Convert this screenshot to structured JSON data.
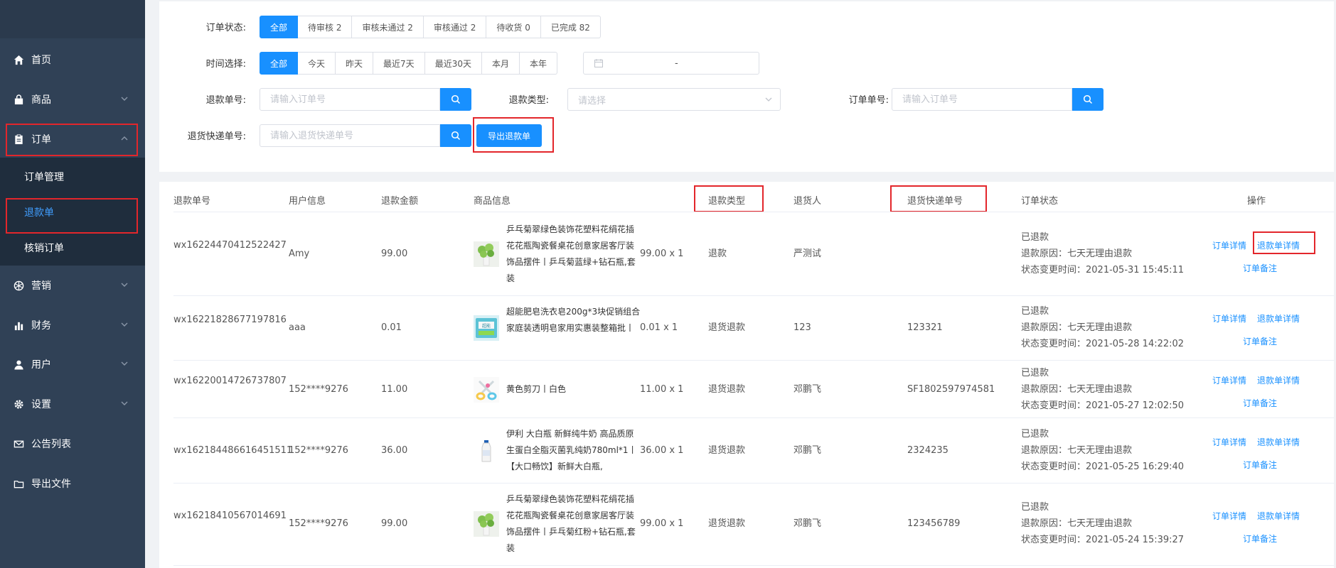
{
  "sidebar": {
    "items": [
      {
        "label": "首页",
        "icon": "home-icon"
      },
      {
        "label": "商品",
        "icon": "bag-icon"
      },
      {
        "label": "订单",
        "icon": "clipboard-icon"
      },
      {
        "label": "营销",
        "icon": "aperture-icon"
      },
      {
        "label": "财务",
        "icon": "bar-chart-icon"
      },
      {
        "label": "用户",
        "icon": "user-icon"
      },
      {
        "label": "设置",
        "icon": "gear-icon"
      },
      {
        "label": "公告列表",
        "icon": "mail-icon"
      },
      {
        "label": "导出文件",
        "icon": "folder-icon"
      }
    ],
    "sub_items": [
      {
        "label": "订单管理"
      },
      {
        "label": "退款单"
      },
      {
        "label": "核销订单"
      }
    ]
  },
  "filters": {
    "status_label": "订单状态:",
    "status_options": [
      "全部",
      "待审核 2",
      "审核未通过 2",
      "审核通过 2",
      "待收货 0",
      "已完成 82"
    ],
    "time_label": "时间选择:",
    "time_options": [
      "全部",
      "今天",
      "昨天",
      "最近7天",
      "最近30天",
      "本月",
      "本年"
    ],
    "date_separator": "-",
    "refund_no_label": "退款单号:",
    "refund_no_placeholder": "请输入订单号",
    "refund_type_label": "退款类型:",
    "refund_type_placeholder": "请选择",
    "order_no_label": "订单单号:",
    "order_no_placeholder": "请输入订单号",
    "return_express_label": "退货快递单号:",
    "return_express_placeholder": "请输入退货快递单号",
    "export_label": "导出退款单"
  },
  "table": {
    "headers": [
      "退款单号",
      "用户信息",
      "退款金额",
      "商品信息",
      "退款类型",
      "退货人",
      "退货快递单号",
      "订单状态",
      "操作"
    ],
    "rows": [
      {
        "refund_no": "wx16224470412522427",
        "user": "Amy",
        "amount": "99.00",
        "product": "乒乓菊翠绿色装饰花塑料花绢花插花花瓶陶瓷餐桌花创意家居客厅装饰品摆件丨乒乓菊蓝绿+钻石瓶,套装",
        "price_qty": "99.00 x 1",
        "type": "退款",
        "returner": "严测试",
        "express": "",
        "status": "已退款",
        "reason": "退款原因：七天无理由退款",
        "time": "状态变更时间：2021-05-31 15:45:11",
        "thumb": "plant"
      },
      {
        "refund_no": "wx16221828677197816",
        "user": "aaa",
        "amount": "0.01",
        "product": "超能肥皂洗衣皂200g*3块促销组合家庭装透明皂家用实惠装整箱批丨",
        "price_qty": "0.01 x 1",
        "type": "退货退款",
        "returner": "123",
        "express": "123321",
        "status": "已退款",
        "reason": "退款原因：七天无理由退款",
        "time": "状态变更时间：2021-05-28 14:22:02",
        "thumb": "soap"
      },
      {
        "refund_no": "wx16220014726737807",
        "user": "152****9276",
        "amount": "11.00",
        "product": "黄色剪刀丨白色",
        "price_qty": "11.00 x 1",
        "type": "退货退款",
        "returner": "邓鹏飞",
        "express": "SF1802597974581",
        "status": "已退款",
        "reason": "退款原因：七天无理由退款",
        "time": "状态变更时间：2021-05-27 12:02:50",
        "thumb": "scissors"
      },
      {
        "refund_no": "wx162184486616451511",
        "user": "152****9276",
        "amount": "36.00",
        "product": "伊利 大白瓶 新鲜纯牛奶 高品质原生蛋白全脂灭菌乳纯奶780ml*1丨【大口畅饮】新鲜大白瓶,",
        "price_qty": "36.00 x 1",
        "type": "退货退款",
        "returner": "邓鹏飞",
        "express": "2324235",
        "status": "已退款",
        "reason": "退款原因：七天无理由退款",
        "time": "状态变更时间：2021-05-25 16:29:40",
        "thumb": "bottle"
      },
      {
        "refund_no": "wx16218410567014691",
        "user": "152****9276",
        "amount": "99.00",
        "product": "乒乓菊翠绿色装饰花塑料花绢花插花花瓶陶瓷餐桌花创意家居客厅装饰品摆件丨乒乓菊红粉+钻石瓶,套装",
        "price_qty": "99.00 x 1",
        "type": "退货退款",
        "returner": "邓鹏飞",
        "express": "123456789",
        "status": "已退款",
        "reason": "退款原因：七天无理由退款",
        "time": "状态变更时间：2021-05-24 15:39:27",
        "thumb": "plant"
      }
    ],
    "action_order_detail": "订单详情",
    "action_refund_detail": "退款单详情",
    "action_remark": "订单备注"
  },
  "colors": {
    "primary": "#1890ff",
    "sidebar": "#304156",
    "sidebar_sub": "#1f2d3d",
    "highlight": "#e3262b"
  }
}
